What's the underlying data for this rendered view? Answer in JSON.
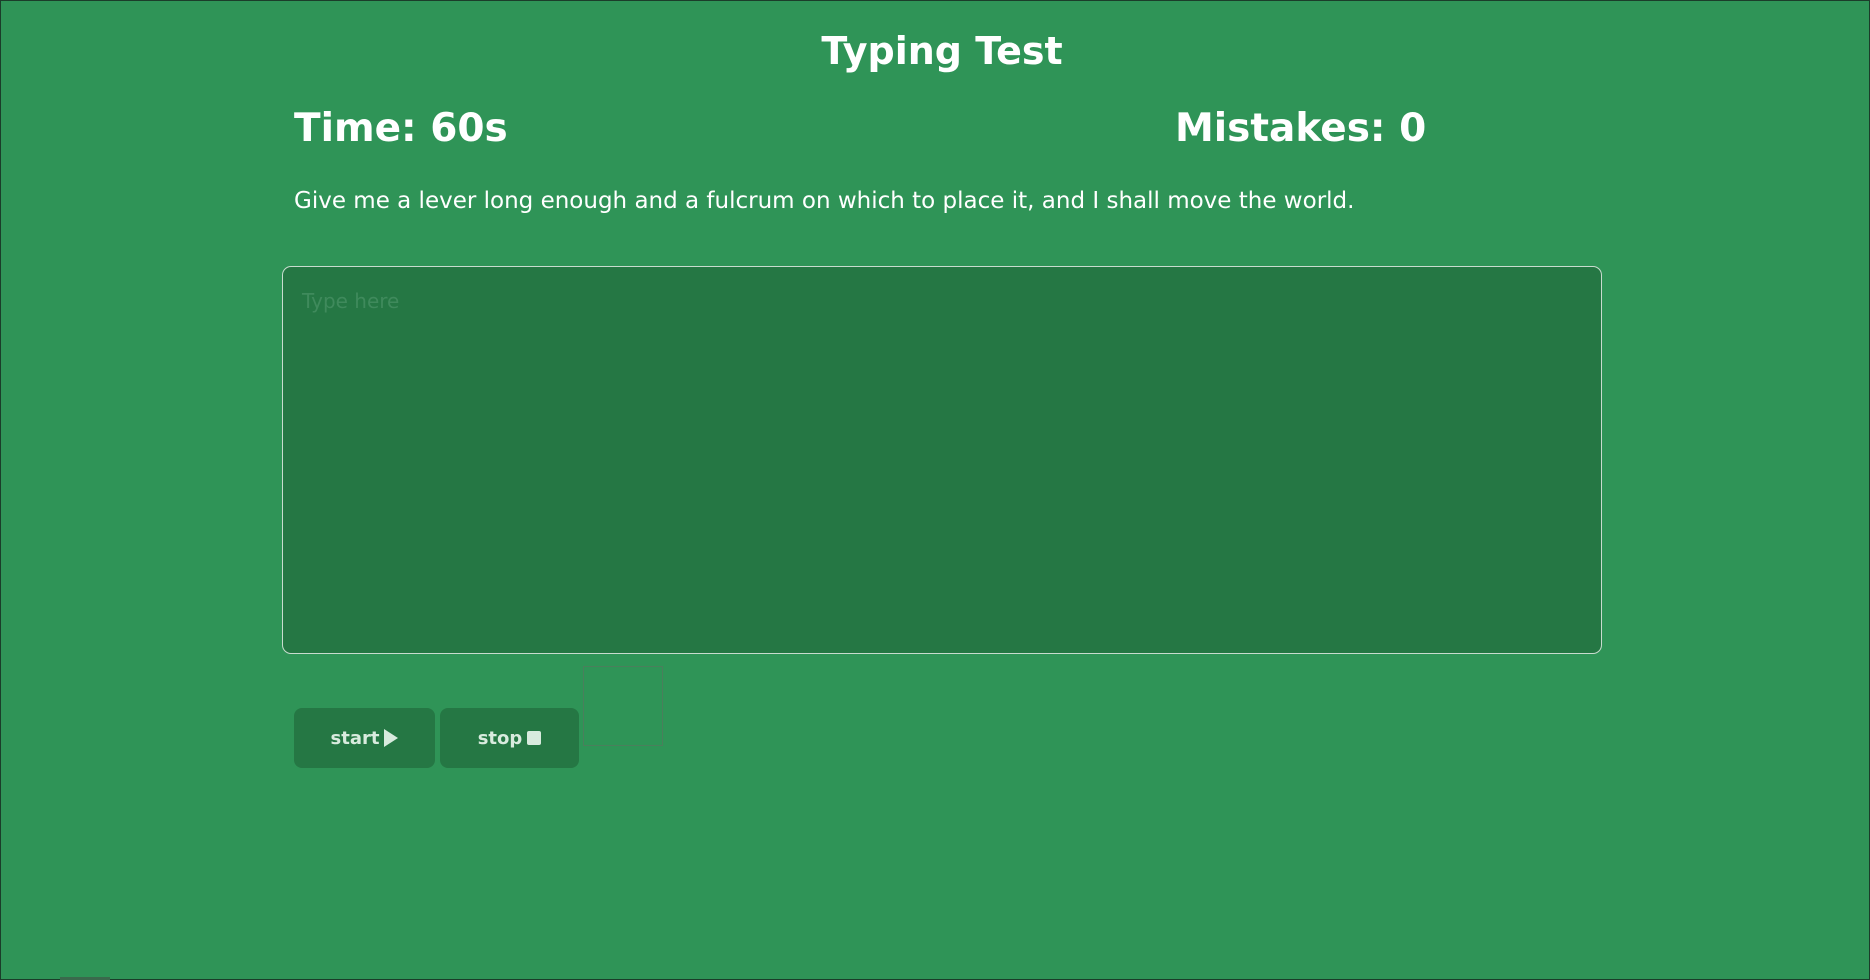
{
  "app": {
    "title": "Typing Test"
  },
  "stats": {
    "time": "Time: 60s",
    "mistakes": "Mistakes: 0"
  },
  "quote": {
    "text": "Give me a lever long enough and a fulcrum on which to place it, and I shall move the world."
  },
  "input": {
    "placeholder": "Type here",
    "value": ""
  },
  "controls": {
    "start_label": "start",
    "start_icon": "play-icon",
    "stop_label": "stop",
    "stop_icon": "stop-icon"
  },
  "colors": {
    "background": "#2f9457",
    "textarea_bg": "#257744",
    "button_bg": "#257744",
    "text": "#ffffff"
  }
}
